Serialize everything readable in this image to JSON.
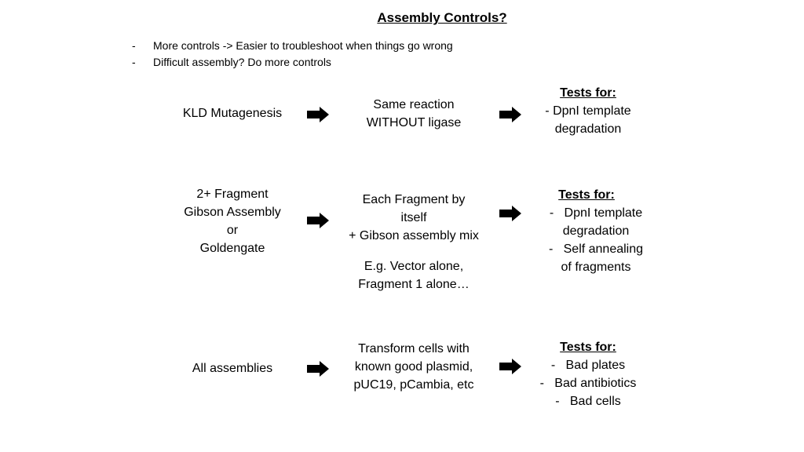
{
  "slide": {
    "title": "Assembly Controls?",
    "bullets": [
      {
        "marker": "-",
        "text": "More controls -> Easier to troubleshoot when things go wrong"
      },
      {
        "marker": "-",
        "text": "Difficult assembly? Do more controls"
      }
    ]
  },
  "rows": [
    {
      "assembly": [
        "KLD Mutagenesis"
      ],
      "control": [
        "Same reaction",
        "WITHOUT ligase"
      ],
      "control_note": [],
      "tests_heading": "Tests for:",
      "tests": [
        "- DpnI template",
        "degradation"
      ]
    },
    {
      "assembly": [
        "2+ Fragment",
        "Gibson Assembly",
        "or",
        "Goldengate"
      ],
      "control": [
        "Each Fragment by",
        "itself",
        "+ Gibson assembly mix"
      ],
      "control_note": [
        "E.g. Vector alone,",
        "Fragment 1 alone…"
      ],
      "tests_heading": "Tests for:",
      "tests": [
        "-   DpnI template",
        "degradation",
        "-   Self annealing",
        "of fragments"
      ]
    },
    {
      "assembly": [
        "All assemblies"
      ],
      "control": [
        "Transform cells with",
        "known good plasmid,",
        "pUC19, pCambia, etc"
      ],
      "control_note": [],
      "tests_heading": "Tests for:",
      "tests": [
        "-   Bad plates",
        "-   Bad antibiotics",
        "-   Bad cells"
      ]
    }
  ],
  "icons": {
    "arrow": "right-block-arrow-icon"
  },
  "colors": {
    "text": "#000000",
    "background": "#ffffff"
  }
}
